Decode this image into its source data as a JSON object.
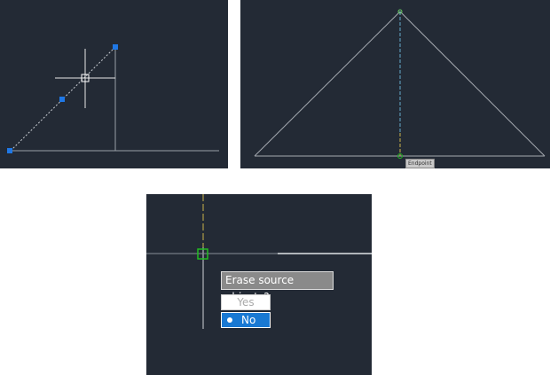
{
  "panels": {
    "p1": {
      "name": "line-grip-edit-view"
    },
    "p2": {
      "name": "triangle-midline-view"
    },
    "p3": {
      "name": "erase-prompt-view"
    }
  },
  "snap_tooltip": {
    "text": "Endpoint"
  },
  "dialog": {
    "prompt": "Erase source objects?",
    "options": [
      {
        "label": "Yes",
        "selected": false
      },
      {
        "label": "No",
        "selected": true
      }
    ]
  },
  "colors": {
    "background": "#232a35",
    "grip": "#1f78e6",
    "selected_option": "#1979d3",
    "snap_marker": "#22bb22",
    "axis_yellow": "#c9b34a",
    "axis_blue": "#66aacc"
  }
}
